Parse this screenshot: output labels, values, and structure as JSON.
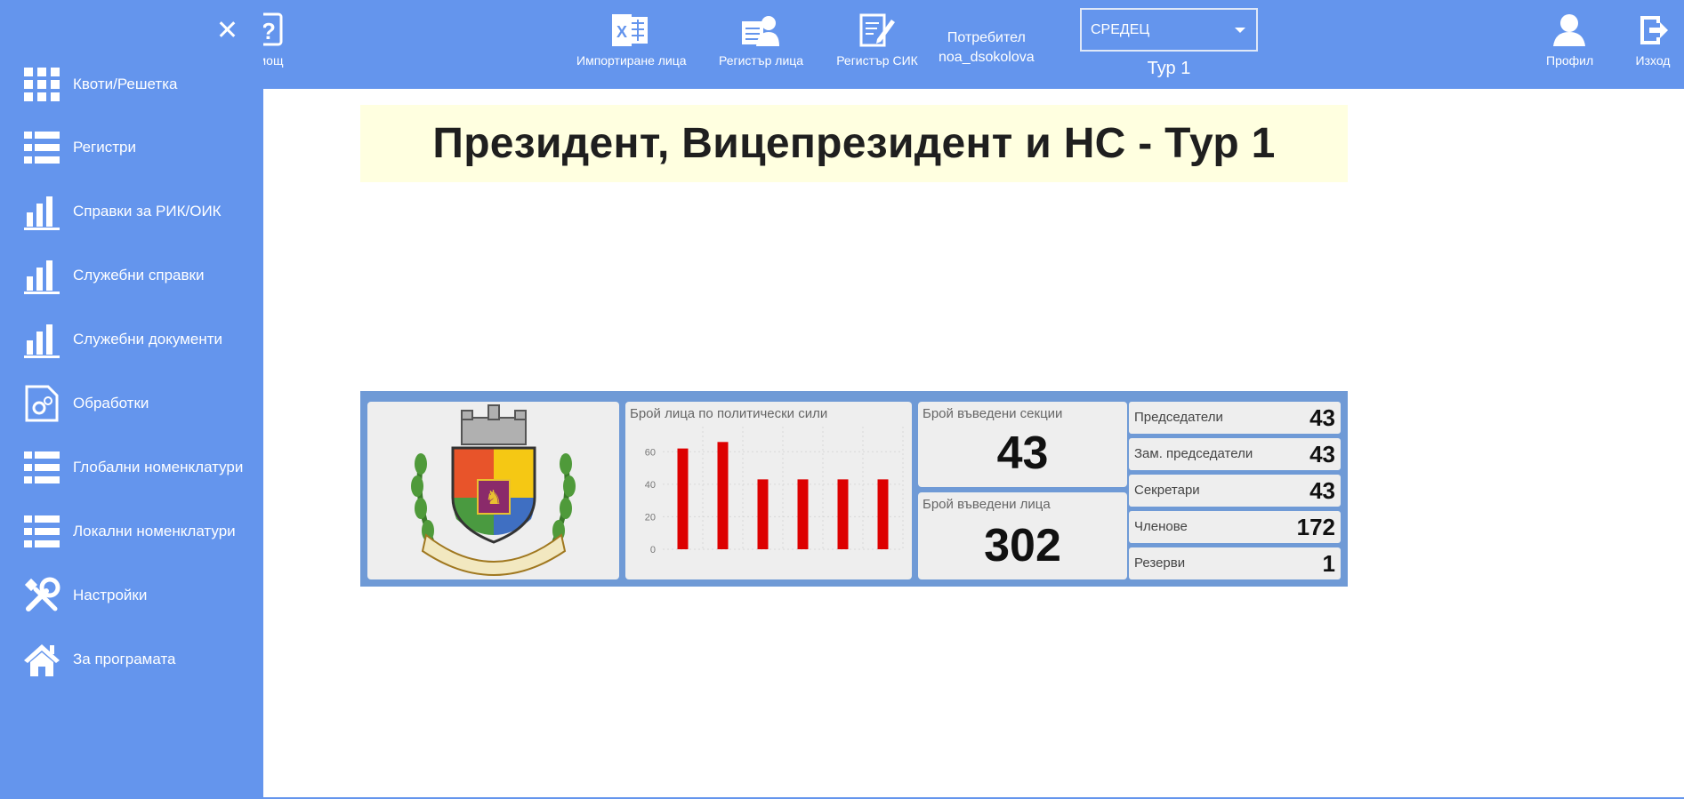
{
  "topbar": {
    "help_label": "мощ",
    "import_label": "Импортиране лица",
    "register_persons_label": "Регистър лица",
    "register_sik_label": "Регистър СИК",
    "user_caption": "Потребител",
    "username": "noa_dsokolova",
    "region_selected": "СРЕДЕЦ",
    "round_label": "Тур 1",
    "profile_label": "Профил",
    "logout_label": "Изход"
  },
  "sidebar": {
    "items": [
      {
        "label": "Квоти/Решетка",
        "icon": "grid-icon"
      },
      {
        "label": "Регистри",
        "icon": "list-icon"
      },
      {
        "label": "Справки за РИК/ОИК",
        "icon": "bar-chart-icon"
      },
      {
        "label": "Служебни справки",
        "icon": "bar-chart-icon"
      },
      {
        "label": "Служебни документи",
        "icon": "bar-chart-icon"
      },
      {
        "label": "Обработки",
        "icon": "document-gear-icon"
      },
      {
        "label": "Глобални номенклатури",
        "icon": "list-icon"
      },
      {
        "label": "Локални номенклатури",
        "icon": "list-icon"
      },
      {
        "label": "Настройки",
        "icon": "tools-icon"
      },
      {
        "label": "За програмата",
        "icon": "home-icon"
      }
    ]
  },
  "main": {
    "title": "Президент, Вицепрезидент и НС - Тур 1"
  },
  "dashboard": {
    "chart_title": "Брой лица по политически сили",
    "sections_title": "Брой въведени секции",
    "sections_value": "43",
    "persons_title": "Брой въведени лица",
    "persons_value": "302",
    "stats": [
      {
        "label": "Председатели",
        "value": "43"
      },
      {
        "label": "Зам. председатели",
        "value": "43"
      },
      {
        "label": "Секретари",
        "value": "43"
      },
      {
        "label": "Членове",
        "value": "172"
      },
      {
        "label": "Резерви",
        "value": "1"
      }
    ]
  },
  "colors": {
    "accent": "#6495ed",
    "bar": "#dd0000",
    "banner": "#ffffe0"
  },
  "chart_data": {
    "type": "bar",
    "values": [
      62,
      66,
      43,
      43,
      43,
      43
    ],
    "ylim": [
      0,
      70
    ],
    "yticks": [
      "0",
      "20",
      "40",
      "60"
    ]
  }
}
